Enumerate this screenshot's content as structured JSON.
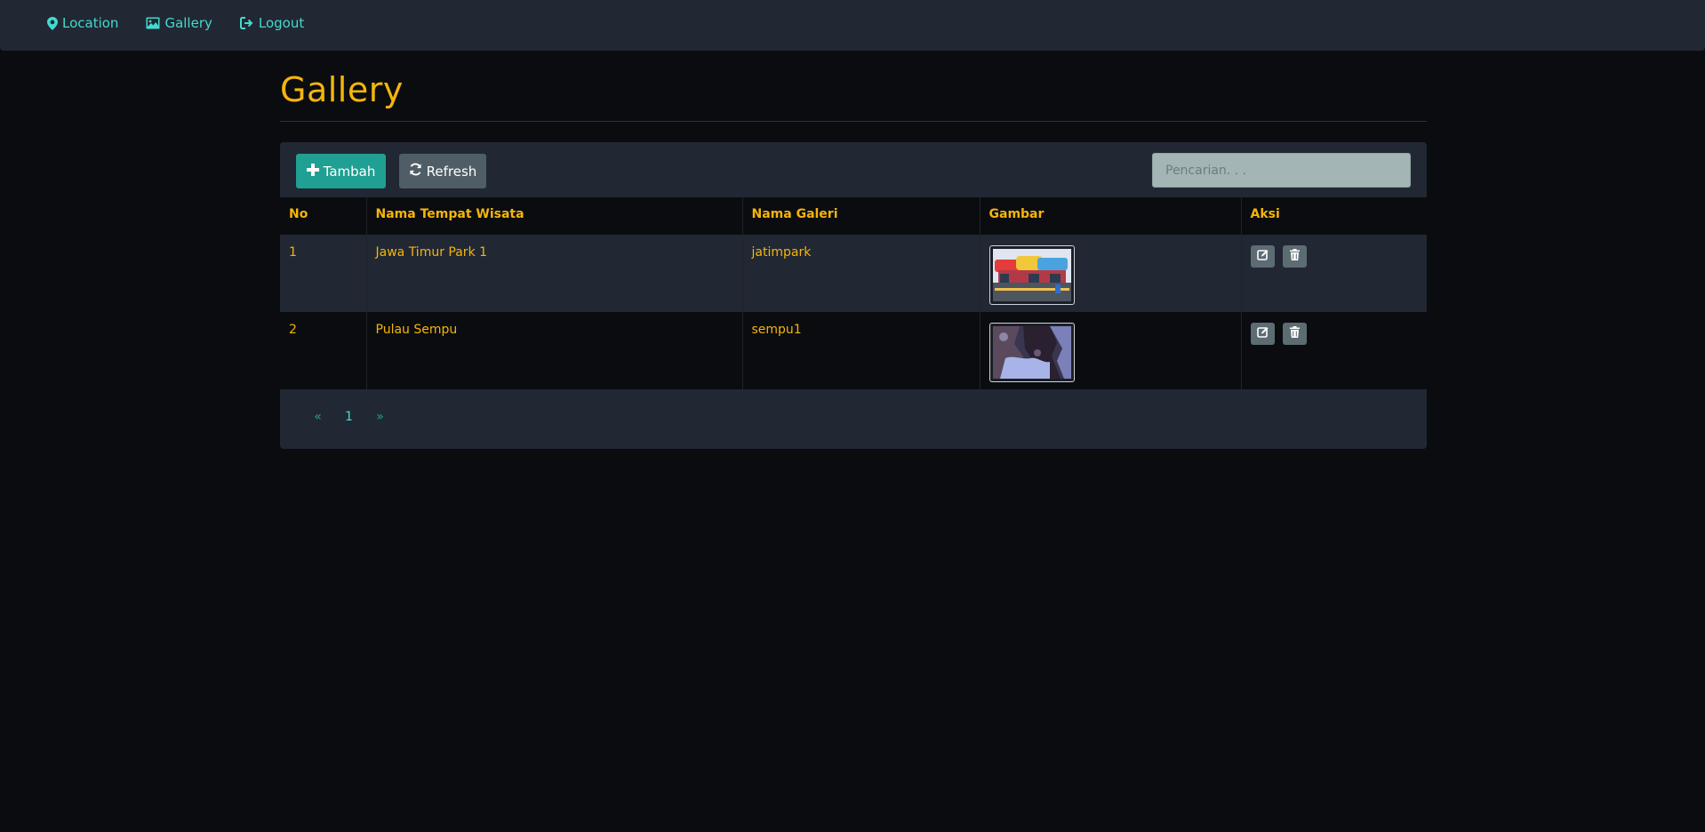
{
  "nav": {
    "items": [
      {
        "label": "Location",
        "icon": "map-marker-icon"
      },
      {
        "label": "Gallery",
        "icon": "image-icon"
      },
      {
        "label": "Logout",
        "icon": "logout-icon"
      }
    ]
  },
  "page": {
    "title": "Gallery"
  },
  "toolbar": {
    "add_label": "Tambah",
    "refresh_label": "Refresh",
    "search_placeholder": "Pencarian. . ."
  },
  "table": {
    "headers": [
      "No",
      "Nama Tempat Wisata",
      "Nama Galeri",
      "Gambar",
      "Aksi"
    ],
    "rows": [
      {
        "no": "1",
        "tempat": "Jawa Timur Park 1",
        "galeri": "jatimpark",
        "image": "theme-park-thumbnail"
      },
      {
        "no": "2",
        "tempat": "Pulau Sempu",
        "galeri": "sempu1",
        "image": "island-cliff-thumbnail"
      }
    ]
  },
  "pagination": {
    "prev": "«",
    "current": "1",
    "next": "»"
  },
  "colors": {
    "accent": "#f5b50a",
    "link": "#44d9d0",
    "primary_button": "#20a092",
    "secondary_button": "#4f5e66",
    "background": "#0a0c10",
    "panel": "#212833"
  }
}
